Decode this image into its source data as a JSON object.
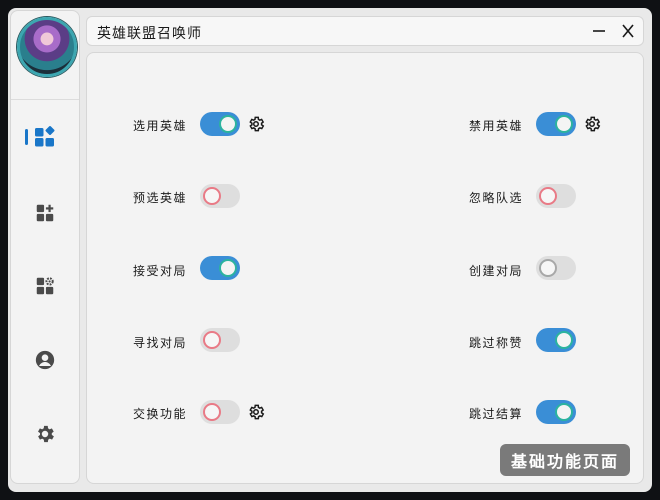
{
  "window": {
    "title": "英雄联盟召唤师"
  },
  "titlebar": {
    "minimize_icon": "minimize-icon",
    "close_icon": "close-icon"
  },
  "sidebar": {
    "items": [
      {
        "name": "basic-functions",
        "icon": "grid-diamond-icon",
        "active": true
      },
      {
        "name": "add-feature",
        "icon": "grid-plus-icon",
        "active": false
      },
      {
        "name": "settings-grid",
        "icon": "grid-gear-icon",
        "active": false
      },
      {
        "name": "profile",
        "icon": "user-icon",
        "active": false
      },
      {
        "name": "settings",
        "icon": "gear-icon",
        "active": false
      }
    ],
    "accent_color": "#1976c8"
  },
  "toggles_left": [
    {
      "label": "选用英雄",
      "on": true,
      "has_settings": true
    },
    {
      "label": "预选英雄",
      "on": false,
      "has_settings": false
    },
    {
      "label": "接受对局",
      "on": true,
      "has_settings": false
    },
    {
      "label": "寻找对局",
      "on": false,
      "has_settings": false
    },
    {
      "label": "交换功能",
      "on": false,
      "has_settings": true
    }
  ],
  "toggles_right": [
    {
      "label": "禁用英雄",
      "on": true,
      "has_settings": true
    },
    {
      "label": "忽略队选",
      "on": false,
      "has_settings": false
    },
    {
      "label": "创建对局",
      "on": false,
      "has_settings": false
    },
    {
      "label": "跳过称赞",
      "on": true,
      "has_settings": false
    },
    {
      "label": "跳过结算",
      "on": true,
      "has_settings": false
    }
  ],
  "page_badge": {
    "label": "基础功能页面"
  },
  "colors": {
    "toggle_on": "#3a8ed6",
    "toggle_off": "#dedede",
    "knob_on_ring": "#2cb39f",
    "knob_off_ring": "#e97a86"
  }
}
